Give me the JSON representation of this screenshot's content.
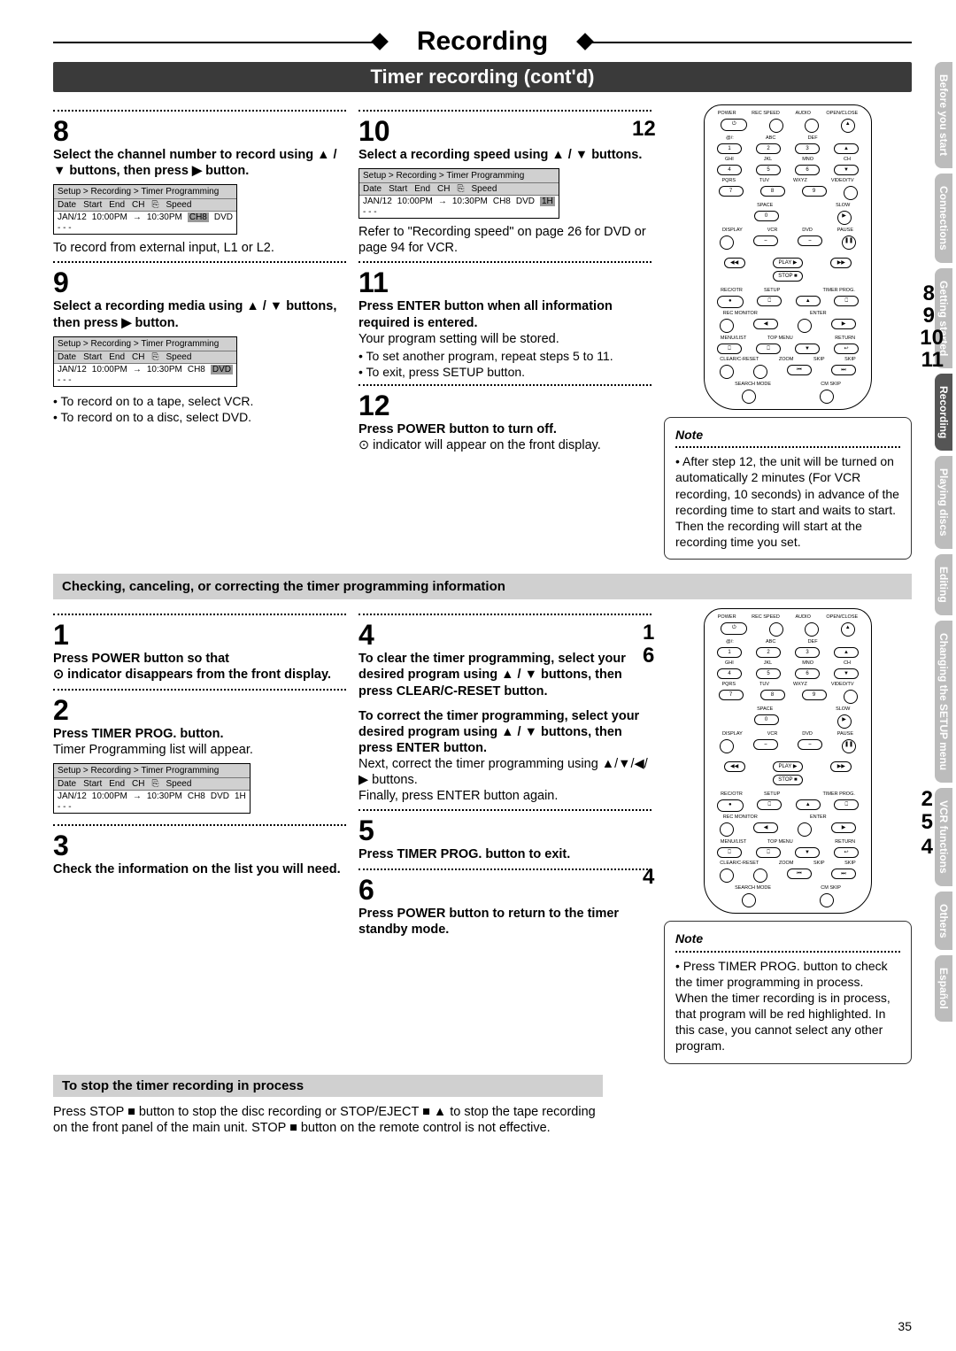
{
  "header": {
    "title": "Recording",
    "subtitle": "Timer recording (cont'd)"
  },
  "side_tabs": [
    "Before you start",
    "Connections",
    "Getting started",
    "Recording",
    "Playing discs",
    "Editing",
    "Changing the SETUP menu",
    "VCR functions",
    "Others",
    "Español"
  ],
  "active_tab": "Recording",
  "menu": {
    "breadcrumb": "Setup > Recording > Timer Programming",
    "cols": [
      "Date",
      "Start",
      "End",
      "CH",
      "⎘",
      "Speed"
    ],
    "row": {
      "date": "JAN/12",
      "start": "10:00PM",
      "arrow": "→",
      "end": "10:30PM",
      "ch": "CH8",
      "media": "DVD",
      "speed": "1H"
    }
  },
  "steps_top": {
    "s8": {
      "num": "8",
      "head": "Select the channel number to record using ▲ / ▼ buttons, then press ▶ button.",
      "body": "To record from external input, L1 or L2."
    },
    "s9": {
      "num": "9",
      "head": "Select a recording media using ▲ / ▼ buttons, then press ▶ button.",
      "b1": "• To record on to a tape, select VCR.",
      "b2": "• To record on to a disc, select DVD."
    },
    "s10": {
      "num": "10",
      "head": "Select a recording speed using ▲ / ▼ buttons.",
      "body": "Refer to \"Recording speed\" on page 26 for DVD or page 94 for VCR."
    },
    "s11": {
      "num": "11",
      "head": "Press ENTER button when all information required is entered.",
      "body": "Your program setting will be stored.",
      "b1": "• To set another program, repeat steps 5 to 11.",
      "b2": "• To exit, press SETUP button."
    },
    "s12": {
      "num": "12",
      "head": "Press POWER button to turn off.",
      "body": "⊙  indicator will appear on the front display."
    }
  },
  "callouts_top": {
    "c12": "12",
    "c8": "8",
    "c9": "9",
    "c10": "10",
    "c11": "11"
  },
  "note_top": {
    "title": "Note",
    "body": "• After step 12, the unit will be turned on automatically 2 minutes (For VCR recording, 10 seconds) in advance of the recording time to start and waits to start. Then the recording will start at the recording time you set."
  },
  "section2": {
    "title": "Checking, canceling, or correcting the timer programming information"
  },
  "steps_bot": {
    "s1": {
      "num": "1",
      "head": "Press POWER button so that",
      "body": "⊙  indicator disappears from the front display."
    },
    "s2": {
      "num": "2",
      "head": "Press TIMER PROG. button.",
      "body": "Timer Programming list will appear."
    },
    "s3": {
      "num": "3",
      "head": "Check the information on the list you will need."
    },
    "s4": {
      "num": "4",
      "head1": "To clear the timer programming, select your desired program using ▲ / ▼ buttons, then press CLEAR/C-RESET button.",
      "head2": "To correct the timer programming, select your desired program using ▲ / ▼ buttons, then press ENTER button.",
      "body": "Next, correct the timer programming using ▲/▼/◀/▶ buttons.\nFinally, press ENTER button again."
    },
    "s5": {
      "num": "5",
      "head": "Press TIMER PROG. button to exit."
    },
    "s6": {
      "num": "6",
      "head": "Press POWER button to return to the timer standby mode."
    }
  },
  "callouts_bot": {
    "c1": "1",
    "c6": "6",
    "c2": "2",
    "c5": "5",
    "c4a": "4",
    "c4b": "4"
  },
  "note_bot": {
    "title": "Note",
    "body": "• Press TIMER PROG. button to check the timer programming in process.\nWhen the timer recording is in process, that program will be red highlighted. In this case, you cannot select any other program."
  },
  "stop": {
    "title": "To stop the timer recording in process",
    "body": "Press STOP ■ button to stop the disc recording or STOP/EJECT ■ ▲ to stop the tape recording on the front panel of the main unit. STOP ■ button on the remote control is not effective."
  },
  "page": "35"
}
